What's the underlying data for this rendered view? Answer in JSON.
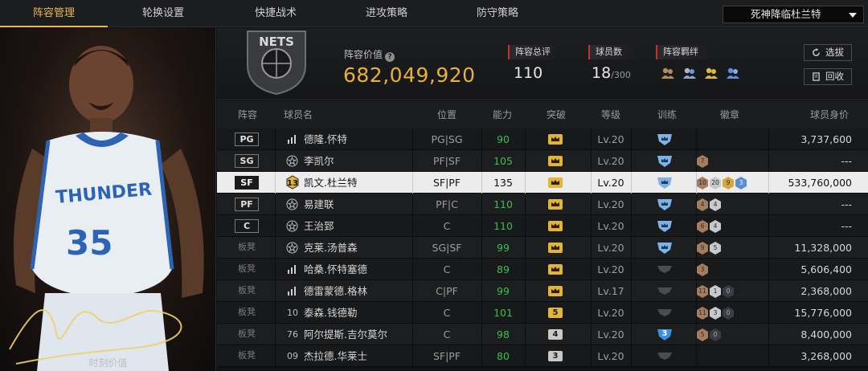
{
  "nav": {
    "tabs": [
      "阵容管理",
      "轮换设置",
      "快捷战术",
      "进攻策略",
      "防守策略"
    ],
    "active_index": 0,
    "lineup_select": "死神降临杜兰特"
  },
  "portrait": {
    "jersey_team": "THUNDER",
    "jersey_number": "35",
    "caption": "时刻价值"
  },
  "summary": {
    "team_logo_text": "NETS",
    "value_label": "阵容价值",
    "value": "682,049,920",
    "overall_label": "阵容总评",
    "overall": "110",
    "player_count_label": "球员数",
    "player_count": "18",
    "player_count_max": "/300",
    "bond_label": "阵容羁绊",
    "select_button": "选拔",
    "recycle_button": "回收"
  },
  "table": {
    "headers": {
      "slot": "阵容",
      "name": "球员名",
      "position": "位置",
      "ability": "能力",
      "breakthrough": "突破",
      "level": "等级",
      "training": "训练",
      "badges": "徽章",
      "value": "球员身价"
    },
    "rows": [
      {
        "slot": "PG",
        "jersey": "bars",
        "name": "德隆.怀特",
        "position": "PG|SG",
        "ability": "90",
        "break": "crown",
        "level": "Lv.20",
        "train": "blue",
        "badges": [],
        "value": "3,737,600"
      },
      {
        "slot": "SG",
        "jersey": "star",
        "name": "李凯尔",
        "position": "PF|SF",
        "ability": "105",
        "break": "crown",
        "level": "Lv.20",
        "train": "blue",
        "badges": [
          {
            "t": "7",
            "c": "bronze"
          }
        ],
        "value": "---"
      },
      {
        "slot": "SF",
        "jersey": "13",
        "name": "凯文.杜兰特",
        "position": "SF|PF",
        "ability": "135",
        "break": "crown",
        "level": "Lv.20",
        "train": "blue",
        "badges": [
          {
            "t": "10",
            "c": "bronze"
          },
          {
            "t": "20",
            "c": "silver"
          },
          {
            "t": "9",
            "c": "gold"
          },
          {
            "t": "3",
            "c": "blue"
          }
        ],
        "value": "533,760,000",
        "selected": true
      },
      {
        "slot": "PF",
        "jersey": "star",
        "name": "易建联",
        "position": "PF|C",
        "ability": "110",
        "break": "crown",
        "level": "Lv.20",
        "train": "blue",
        "badges": [
          {
            "t": "4",
            "c": "bronze"
          },
          {
            "t": "4",
            "c": "silver"
          }
        ],
        "value": "---"
      },
      {
        "slot": "C",
        "jersey": "star",
        "name": "王治郅",
        "position": "C",
        "ability": "110",
        "break": "crown",
        "level": "Lv.20",
        "train": "blue",
        "badges": [
          {
            "t": "6",
            "c": "bronze"
          },
          {
            "t": "4",
            "c": "silver"
          }
        ],
        "value": "---"
      },
      {
        "slot": "板凳",
        "jersey": "star",
        "name": "克莱.汤普森",
        "position": "SG|SF",
        "ability": "99",
        "break": "crown",
        "level": "Lv.20",
        "train": "blue",
        "badges": [
          {
            "t": "9",
            "c": "bronze"
          },
          {
            "t": "5",
            "c": "silver"
          }
        ],
        "value": "11,328,000"
      },
      {
        "slot": "板凳",
        "jersey": "bars",
        "name": "哈桑.怀特塞德",
        "position": "C",
        "ability": "89",
        "break": "crown",
        "level": "Lv.20",
        "train": "gray",
        "badges": [
          {
            "t": "3",
            "c": "bronze"
          }
        ],
        "value": "5,606,400"
      },
      {
        "slot": "板凳",
        "jersey": "bars",
        "name": "德雷蒙德.格林",
        "position": "C|PF",
        "ability": "99",
        "break": "crown",
        "level": "Lv.17",
        "train": "gray",
        "badges": [
          {
            "t": "11",
            "c": "bronze"
          },
          {
            "t": "1",
            "c": "silver"
          },
          {
            "t": "0",
            "c": "dark"
          }
        ],
        "value": "2,368,000"
      },
      {
        "slot": "板凳",
        "jersey": "10",
        "name": "泰森.钱德勒",
        "position": "C",
        "ability": "101",
        "break": "5",
        "level": "Lv.20",
        "train": "gray",
        "badges": [
          {
            "t": "11",
            "c": "bronze"
          },
          {
            "t": "3",
            "c": "silver"
          },
          {
            "t": "0",
            "c": "dark"
          }
        ],
        "value": "15,776,000"
      },
      {
        "slot": "板凳",
        "jersey": "76",
        "name": "阿尔提斯.吉尔莫尔",
        "position": "C",
        "ability": "98",
        "break": "4",
        "level": "Lv.20",
        "train": "3",
        "badges": [
          {
            "t": "5",
            "c": "bronze"
          },
          {
            "t": "0",
            "c": "dark"
          }
        ],
        "value": "8,400,000"
      },
      {
        "slot": "板凳",
        "jersey": "09",
        "name": "杰拉德.华莱士",
        "position": "SF|PF",
        "ability": "80",
        "break": "3",
        "level": "Lv.20",
        "train": "gray",
        "badges": [],
        "value": "3,268,000"
      }
    ]
  }
}
